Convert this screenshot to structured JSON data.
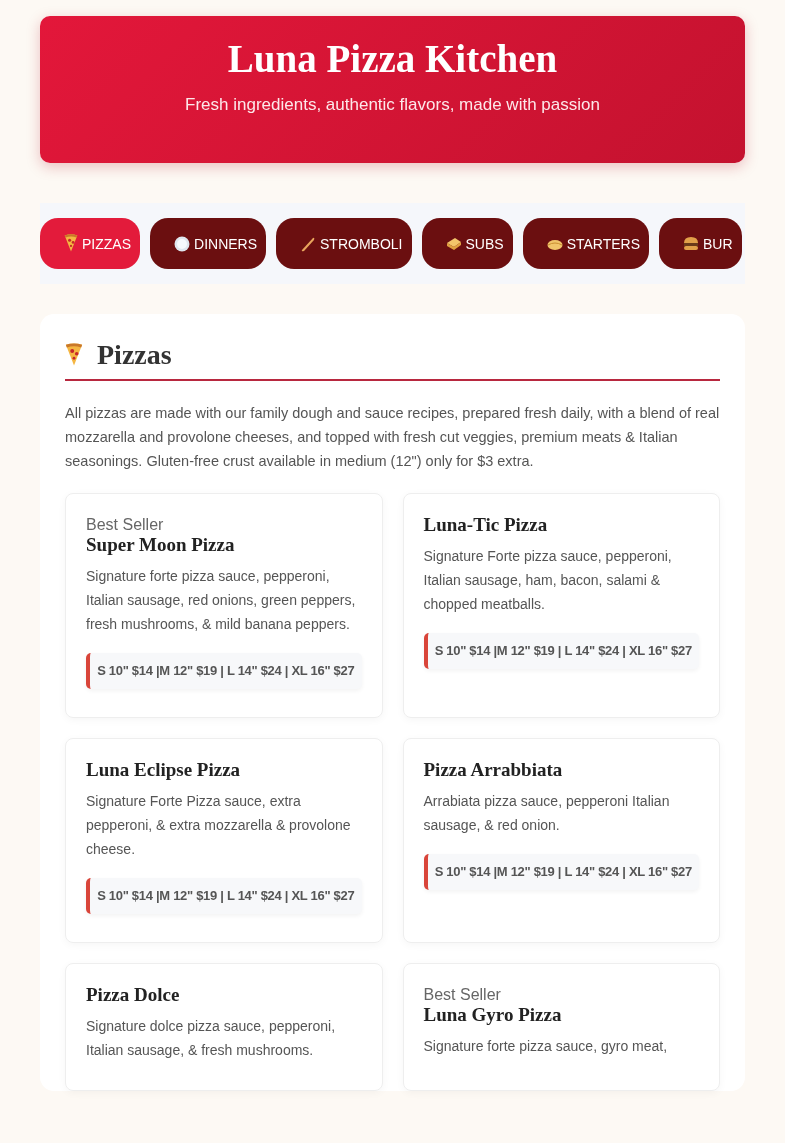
{
  "header": {
    "title": "Luna Pizza Kitchen",
    "tagline": "Fresh ingredients, authentic flavors, made with passion"
  },
  "tabs": [
    {
      "label": "PIZZAS",
      "selected": true
    },
    {
      "label": "DINNERS",
      "selected": false
    },
    {
      "label": "STROMBOLI",
      "selected": false
    },
    {
      "label": "SUBS",
      "selected": false
    },
    {
      "label": "STARTERS",
      "selected": false
    },
    {
      "label": "BUR",
      "selected": false
    }
  ],
  "section": {
    "title": "Pizzas",
    "description": "All pizzas are made with our family dough and sauce recipes, prepared fresh daily, with a blend of real mozzarella and provolone cheeses, and topped with fresh cut veggies, premium meats & Italian seasonings. Gluten-free crust available in medium (12\") only for $3 extra.",
    "items": [
      {
        "badge": "Best Seller",
        "name": "Super Moon Pizza",
        "description": "Signature forte pizza sauce, pepperoni, Italian sausage, red onions, green peppers, fresh mushrooms, & mild banana peppers.",
        "price": "S 10\" $14 |M 12\" $19 | L 14\" $24 | XL 16\" $27"
      },
      {
        "name": "Luna-Tic Pizza",
        "description": "Signature Forte pizza sauce, pepperoni, Italian sausage, ham, bacon, salami & chopped meatballs.",
        "price": "S 10\" $14 |M 12\" $19 | L 14\" $24 | XL 16\" $27"
      },
      {
        "name": "Luna Eclipse Pizza",
        "description": "Signature Forte Pizza sauce, extra pepperoni, & extra mozzarella & provolone cheese.",
        "price": "S 10\" $14 |M 12\" $19 | L 14\" $24 | XL 16\" $27"
      },
      {
        "name": "Pizza Arrabbiata",
        "description": "Arrabiata pizza sauce, pepperoni Italian sausage, & red onion.",
        "price": "S 10\" $14 |M 12\" $19 | L 14\" $24 | XL 16\" $27"
      },
      {
        "name": "Pizza Dolce",
        "description": "Signature dolce pizza sauce, pepperoni, Italian sausage, & fresh mushrooms."
      },
      {
        "badge": "Best Seller",
        "name": "Luna Gyro Pizza",
        "description": "Signature forte pizza sauce, gyro meat,"
      }
    ]
  }
}
